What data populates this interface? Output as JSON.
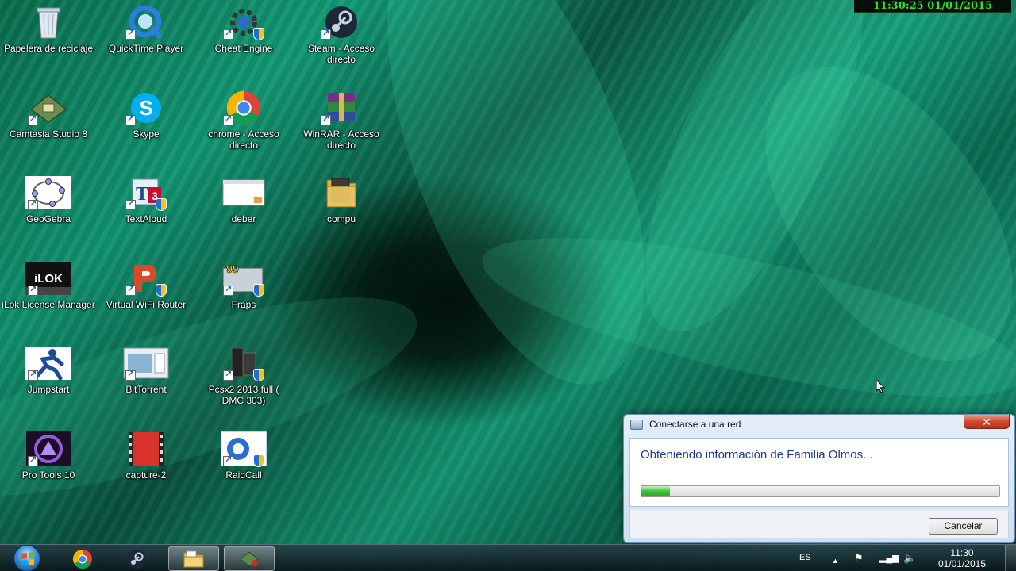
{
  "overlay_clock": "11:30:25  01/01/2015",
  "desktop_icons": [
    {
      "label": "Papelera de reciclaje",
      "icon": "recycle-bin-icon"
    },
    {
      "label": "QuickTime Player",
      "icon": "quicktime-icon"
    },
    {
      "label": "Cheat Engine",
      "icon": "cheat-engine-icon"
    },
    {
      "label": "Steam - Acceso directo",
      "icon": "steam-icon"
    },
    {
      "label": "Camtasia Studio 8",
      "icon": "camtasia-icon"
    },
    {
      "label": "Skype",
      "icon": "skype-icon"
    },
    {
      "label": "chrome - Acceso directo",
      "icon": "chrome-icon"
    },
    {
      "label": "WinRAR - Acceso directo",
      "icon": "winrar-icon"
    },
    {
      "label": "GeoGebra",
      "icon": "geogebra-icon"
    },
    {
      "label": "TextAloud",
      "icon": "textaloud-icon"
    },
    {
      "label": "deber",
      "icon": "document-icon"
    },
    {
      "label": "compu",
      "icon": "folder-icon"
    },
    {
      "label": "iLok License Manager",
      "icon": "ilok-icon"
    },
    {
      "label": "Virtual WiFi Router",
      "icon": "wifi-router-icon"
    },
    {
      "label": "Fraps",
      "icon": "fraps-icon"
    },
    {
      "label": "Jumpstart",
      "icon": "jumpstart-icon"
    },
    {
      "label": "BitTorrent",
      "icon": "bittorrent-icon"
    },
    {
      "label": "Pcsx2 2013 full ( DMC 303)",
      "icon": "pcsx2-icon"
    },
    {
      "label": "Pro Tools 10",
      "icon": "pro-tools-icon"
    },
    {
      "label": "capture-2",
      "icon": "video-file-icon"
    },
    {
      "label": "RaidCall",
      "icon": "raidcall-icon"
    }
  ],
  "dialog": {
    "title": "Conectarse a una red",
    "heading": "Obteniendo información de Familia Olmos...",
    "progress": 0.08,
    "cancel_label": "Cancelar",
    "close_icon": "close-icon"
  },
  "taskbar": {
    "start_icon": "windows-start-icon",
    "pinned": [
      {
        "icon": "chrome-icon",
        "active": false
      },
      {
        "icon": "steam-icon",
        "active": false
      },
      {
        "icon": "folder-icon",
        "active": true
      },
      {
        "icon": "camtasia-icon",
        "active": true
      }
    ],
    "language": "ES",
    "tray_icons": [
      "show-hidden-icons-arrow",
      "action-center-flag-icon",
      "network-icon",
      "volume-icon"
    ],
    "time": "11:30",
    "date": "01/01/2015"
  },
  "colors": {
    "accent_title": "#1c3a8c",
    "progress_green": "#3ec23a",
    "clock_green": "#35e035",
    "wallpaper_green": "#12a07a"
  }
}
